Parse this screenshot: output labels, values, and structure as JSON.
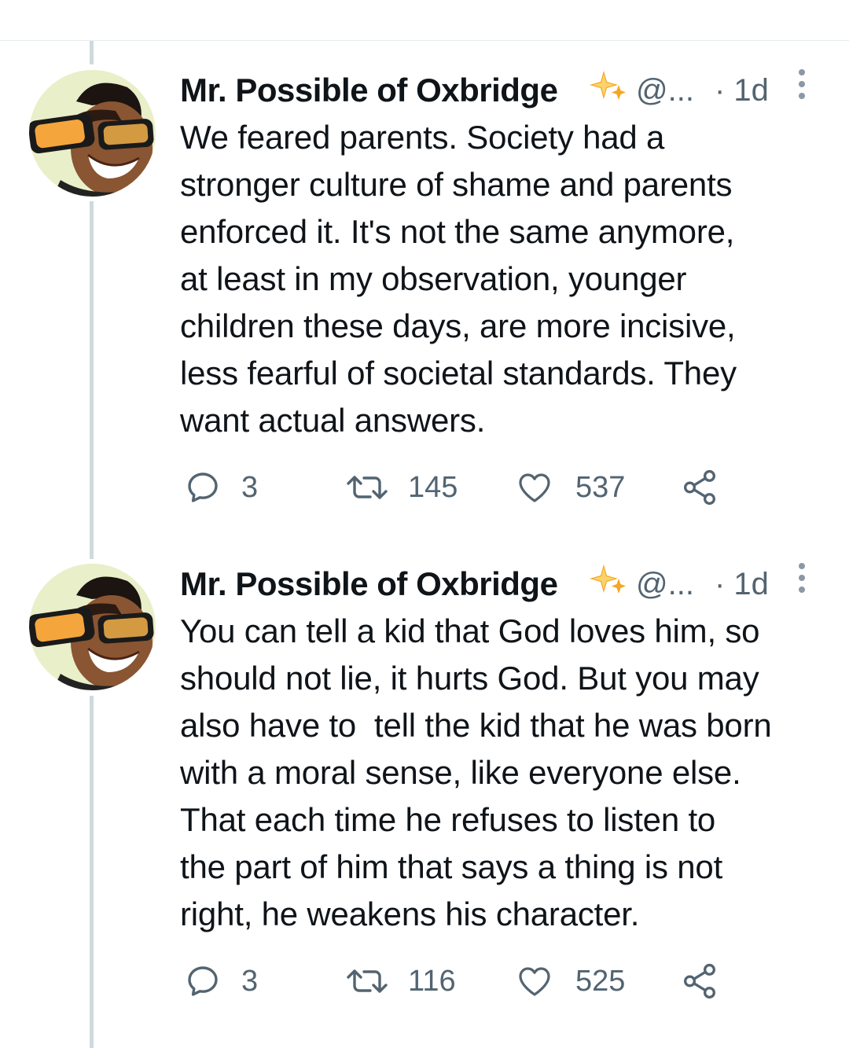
{
  "tweets": [
    {
      "author_name": "Mr. Possible of Oxbridge",
      "verified_badge_icon": "sparkle-icon",
      "handle": "@...",
      "time": "· 1d",
      "text": "We feared parents. Society had a stronger culture of shame and parents enforced it. It's not the same anymore, at least in my observation, younger children these days, are more incisive, less fearful of societal standards. They want actual answers.",
      "text_lines": [
        "We feared parents. Society had a",
        "stronger culture of shame and parents",
        "enforced it. It's not the same anymore,",
        "at least in my observation, younger",
        "children these days, are more incisive,",
        "less fearful of societal standards. They",
        "want actual answers."
      ],
      "replies": "3",
      "retweets": "145",
      "likes": "537"
    },
    {
      "author_name": "Mr. Possible of Oxbridge",
      "verified_badge_icon": "sparkle-icon",
      "handle": "@...",
      "time": "· 1d",
      "text": "You can tell a kid that God loves him, so should not lie, it hurts God. But you may also have to  tell the kid that he was born with a moral sense, like everyone else. That each time he refuses to listen to the part of him that says a thing is not right, he weakens his character.",
      "text_lines": [
        "You can tell a kid that God loves him, so",
        "should not lie, it hurts God. But you may",
        "also have to  tell the kid that he was born",
        "with a moral sense, like everyone else.",
        "That each time he refuses to listen to",
        "the part of him that says a thing is not",
        "right, he weakens his character."
      ],
      "replies": "3",
      "retweets": "116",
      "likes": "525"
    }
  ],
  "icons": {
    "reply": "reply-icon",
    "retweet": "retweet-icon",
    "like": "heart-icon",
    "share": "share-icon",
    "more": "more-options-icon"
  },
  "colors": {
    "text": "#0f1419",
    "secondary": "#536471",
    "thread_line": "#cfd9de",
    "sparkle": "#f5a623"
  }
}
